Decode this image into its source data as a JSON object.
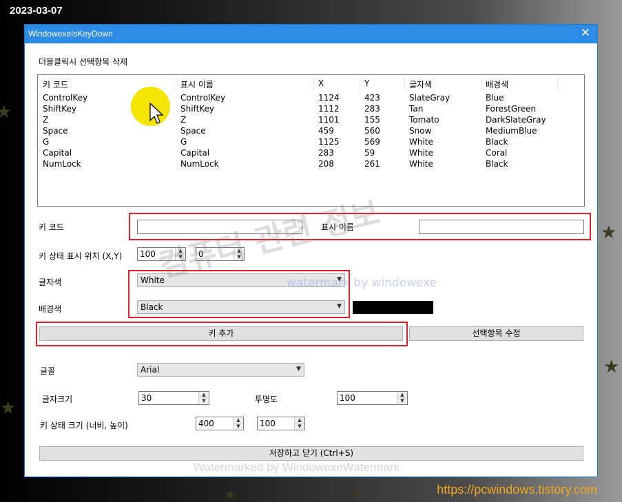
{
  "overlay": {
    "date": "2023-03-07",
    "url": "https://pcwindows.tistory.com",
    "watermark_1": "컴퓨터 관련 정보",
    "watermark_2": "watermark by windowexe",
    "watermark_3": "Watermarked by WindowexeWatermark"
  },
  "window": {
    "title": "WindowexeIsKeyDown",
    "close_glyph": "✕"
  },
  "hint": "더블클릭시 선택항목 삭제",
  "list": {
    "columns": [
      "키 코드",
      "표시 이름",
      "X",
      "Y",
      "글자색",
      "배경색"
    ],
    "rows": [
      [
        "ControlKey",
        "ControlKey",
        "1124",
        "423",
        "SlateGray",
        "Blue"
      ],
      [
        "ShiftKey",
        "ShiftKey",
        "1112",
        "283",
        "Tan",
        "ForestGreen"
      ],
      [
        "Z",
        "Z",
        "1101",
        "155",
        "Tomato",
        "DarkSlateGray"
      ],
      [
        "Space",
        "Space",
        "459",
        "560",
        "Snow",
        "MediumBlue"
      ],
      [
        "G",
        "G",
        "1125",
        "569",
        "White",
        "Black"
      ],
      [
        "Capital",
        "Capital",
        "283",
        "59",
        "White",
        "Coral"
      ],
      [
        "NumLock",
        "NumLock",
        "208",
        "261",
        "White",
        "Black"
      ]
    ]
  },
  "form": {
    "keycode_label": "키 코드",
    "keycode_value": "",
    "display_label": "표시 이름",
    "display_value": "",
    "position_label": "키 상태 표시 위치 (X,Y)",
    "pos_x": "100",
    "pos_y": "0",
    "fore_label": "글자색",
    "fore_value": "White",
    "back_label": "배경색",
    "back_value": "Black",
    "back_swatch_color": "#000000",
    "add_button": "키 추가",
    "edit_button": "선택항목 수정",
    "font_label": "글꼴",
    "font_value": "Arial",
    "size_label": "글자크기",
    "size_value": "30",
    "opacity_label": "투명도",
    "opacity_value": "100",
    "boxsize_label": "키 상태 크기 (너비, 높이)",
    "box_width": "400",
    "box_height": "100",
    "save_button": "저장하고 닫기 (Ctrl+S)"
  },
  "colors": {
    "titlebar": "#2b8be6",
    "highlight_box": "#e0202a",
    "url_text": "#f0a820",
    "cursor_highlight": "#f5e400"
  }
}
